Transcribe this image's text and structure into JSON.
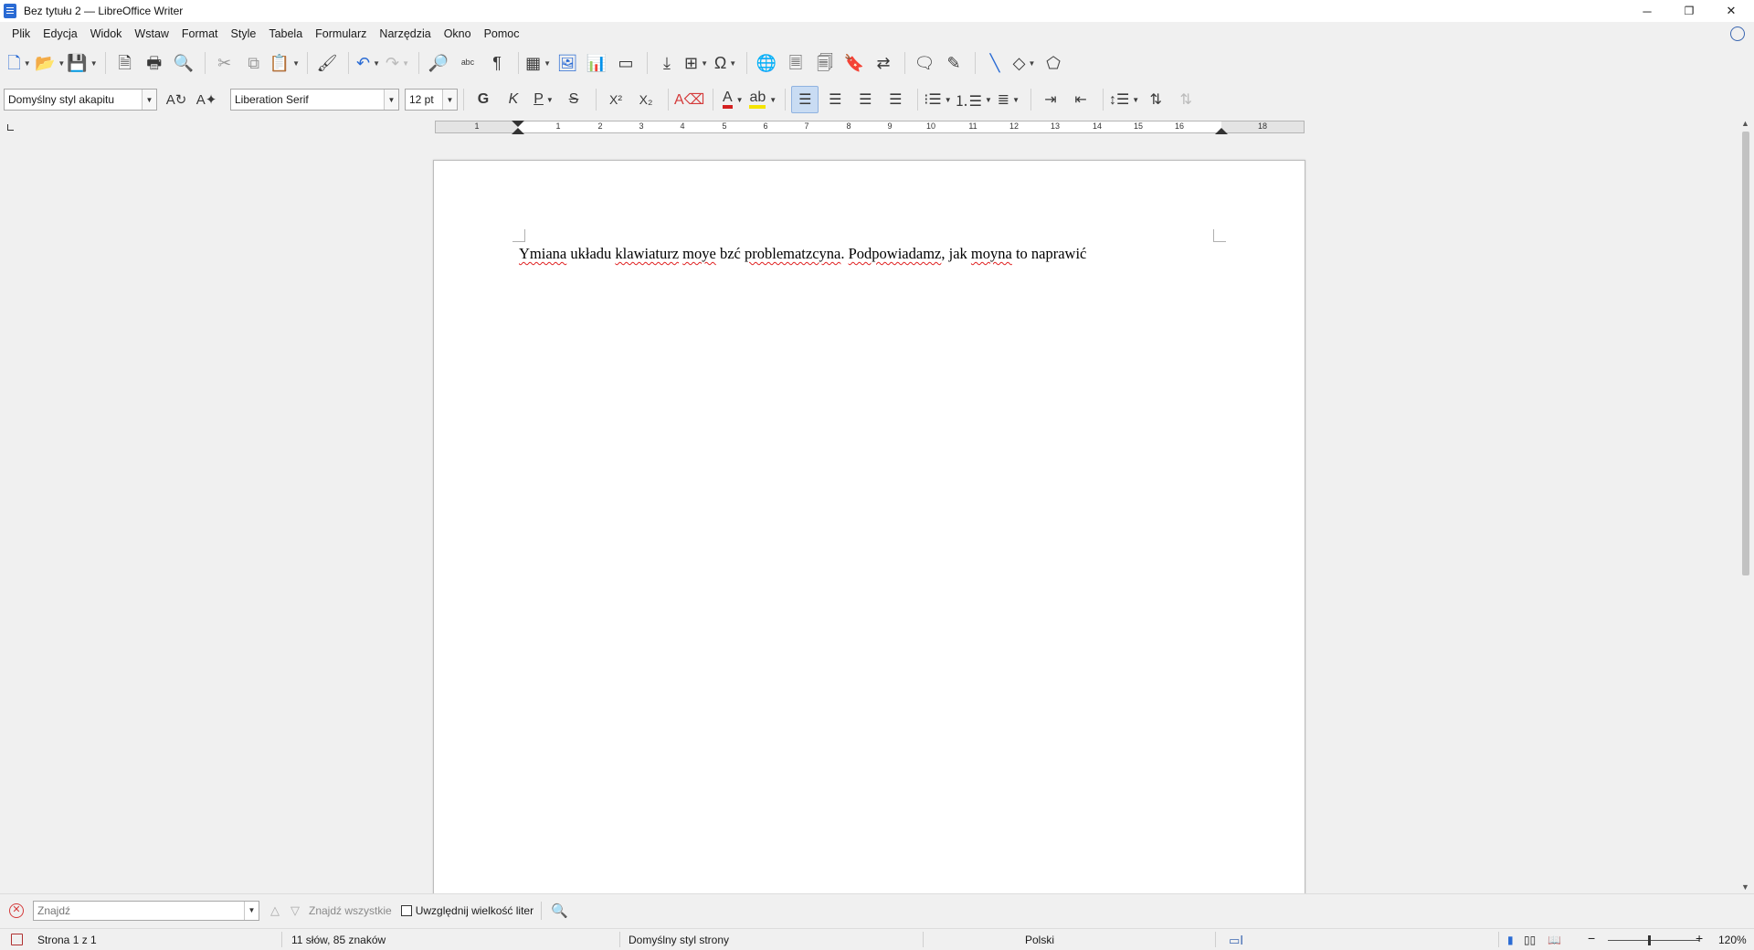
{
  "window": {
    "title": "Bez tytułu 2 — LibreOffice Writer",
    "controls": {
      "minimize": "─",
      "maximize": "❐",
      "close": "✕"
    }
  },
  "menu": [
    "Plik",
    "Edycja",
    "Widok",
    "Wstaw",
    "Format",
    "Style",
    "Tabela",
    "Formularz",
    "Narzędzia",
    "Okno",
    "Pomoc"
  ],
  "formatting": {
    "paragraph_style": "Domyślny styl akapitu",
    "font_name": "Liberation Serif",
    "font_size": "12 pt",
    "bold": "G",
    "italic": "K",
    "underline": "P",
    "strikethrough": "S"
  },
  "ruler": {
    "numbers": [
      "1",
      "1",
      "2",
      "3",
      "4",
      "5",
      "6",
      "7",
      "8",
      "9",
      "10",
      "11",
      "12",
      "13",
      "14",
      "15",
      "16",
      "18"
    ]
  },
  "document": {
    "words": [
      {
        "text": "Ymiana",
        "misspelled": true
      },
      {
        "text": " układu ",
        "misspelled": false
      },
      {
        "text": "klawiaturz",
        "misspelled": true
      },
      {
        "text": " ",
        "misspelled": false
      },
      {
        "text": "moye",
        "misspelled": true
      },
      {
        "text": " bzć ",
        "misspelled": false
      },
      {
        "text": "problematzcyna",
        "misspelled": true
      },
      {
        "text": ". ",
        "misspelled": false
      },
      {
        "text": "Podpowiadamz",
        "misspelled": true
      },
      {
        "text": ", jak ",
        "misspelled": false
      },
      {
        "text": "moyna",
        "misspelled": true
      },
      {
        "text": " to naprawić",
        "misspelled": false
      }
    ]
  },
  "findbar": {
    "placeholder": "Znajdź",
    "find_all": "Znajdź wszystkie",
    "match_case": "Uwzględnij wielkość liter"
  },
  "statusbar": {
    "page": "Strona 1 z 1",
    "words": "11 słów, 85 znaków",
    "page_style": "Domyślny styl strony",
    "language": "Polski",
    "zoom_minus": "−",
    "zoom_plus": "+",
    "zoom": "120%"
  },
  "colors": {
    "spell_underline": "#e02020",
    "font_color": "#d42020",
    "highlight_color": "#f5e400",
    "active_button": "#c9dcf3"
  }
}
